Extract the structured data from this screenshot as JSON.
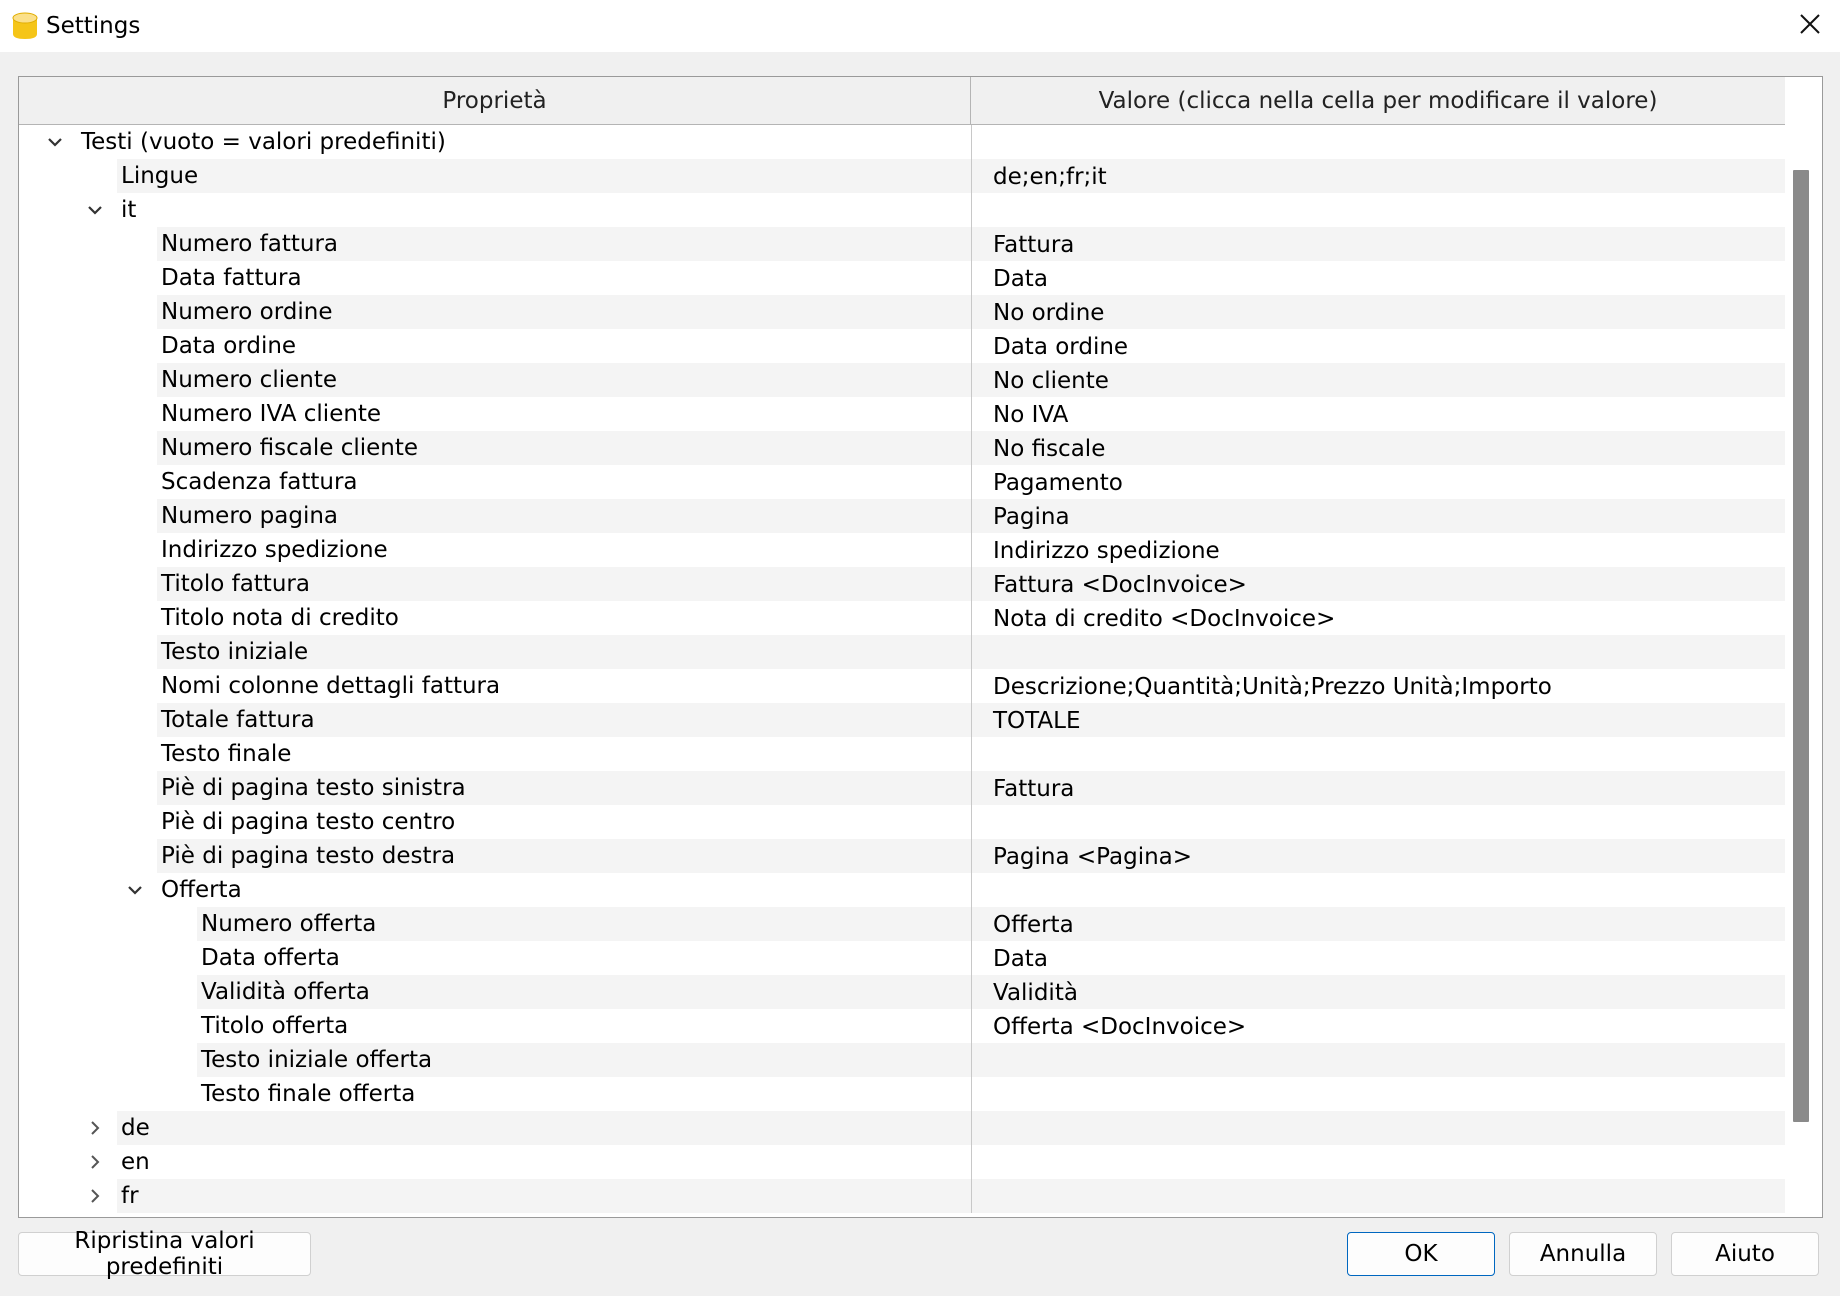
{
  "window": {
    "title": "Settings",
    "app_icon": "database-icon",
    "close_icon": "close-icon"
  },
  "table": {
    "columns": [
      "Proprietà",
      "Valore (clicca nella cella per modificare il valore)"
    ],
    "rows": [
      {
        "label": "Testi (vuoto = valori predefiniti)",
        "value": "",
        "level": 0,
        "expander": "expanded"
      },
      {
        "label": "Lingue",
        "value": "de;en;fr;it",
        "level": 1,
        "expander": "none"
      },
      {
        "label": "it",
        "value": "",
        "level": 1,
        "expander": "expanded"
      },
      {
        "label": "Numero fattura",
        "value": "Fattura",
        "level": 2,
        "expander": "none"
      },
      {
        "label": "Data fattura",
        "value": "Data",
        "level": 2,
        "expander": "none"
      },
      {
        "label": "Numero ordine",
        "value": "No ordine",
        "level": 2,
        "expander": "none"
      },
      {
        "label": "Data ordine",
        "value": "Data ordine",
        "level": 2,
        "expander": "none"
      },
      {
        "label": "Numero cliente",
        "value": "No cliente",
        "level": 2,
        "expander": "none"
      },
      {
        "label": "Numero IVA cliente",
        "value": "No IVA",
        "level": 2,
        "expander": "none"
      },
      {
        "label": "Numero fiscale cliente",
        "value": "No fiscale",
        "level": 2,
        "expander": "none"
      },
      {
        "label": "Scadenza fattura",
        "value": "Pagamento",
        "level": 2,
        "expander": "none"
      },
      {
        "label": "Numero pagina",
        "value": "Pagina",
        "level": 2,
        "expander": "none"
      },
      {
        "label": "Indirizzo spedizione",
        "value": "Indirizzo spedizione",
        "level": 2,
        "expander": "none"
      },
      {
        "label": "Titolo fattura",
        "value": "Fattura <DocInvoice>",
        "level": 2,
        "expander": "none"
      },
      {
        "label": "Titolo nota di credito",
        "value": "Nota di credito <DocInvoice>",
        "level": 2,
        "expander": "none"
      },
      {
        "label": "Testo iniziale",
        "value": "",
        "level": 2,
        "expander": "none"
      },
      {
        "label": "Nomi colonne dettagli fattura",
        "value": "Descrizione;Quantità;Unità;Prezzo Unità;Importo",
        "level": 2,
        "expander": "none"
      },
      {
        "label": "Totale fattura",
        "value": "TOTALE",
        "level": 2,
        "expander": "none"
      },
      {
        "label": "Testo finale",
        "value": "",
        "level": 2,
        "expander": "none"
      },
      {
        "label": "Piè di pagina testo sinistra",
        "value": "Fattura",
        "level": 2,
        "expander": "none"
      },
      {
        "label": "Piè di pagina testo centro",
        "value": "",
        "level": 2,
        "expander": "none"
      },
      {
        "label": "Piè di pagina testo destra",
        "value": "Pagina <Pagina>",
        "level": 2,
        "expander": "none"
      },
      {
        "label": "Offerta",
        "value": "",
        "level": 2,
        "expander": "expanded"
      },
      {
        "label": "Numero offerta",
        "value": "Offerta",
        "level": 3,
        "expander": "none"
      },
      {
        "label": "Data offerta",
        "value": "Data",
        "level": 3,
        "expander": "none"
      },
      {
        "label": "Validità offerta",
        "value": "Validità",
        "level": 3,
        "expander": "none"
      },
      {
        "label": "Titolo offerta",
        "value": "Offerta <DocInvoice>",
        "level": 3,
        "expander": "none"
      },
      {
        "label": "Testo iniziale offerta",
        "value": "",
        "level": 3,
        "expander": "none"
      },
      {
        "label": "Testo finale offerta",
        "value": "",
        "level": 3,
        "expander": "none"
      },
      {
        "label": "de",
        "value": "",
        "level": 1,
        "expander": "collapsed"
      },
      {
        "label": "en",
        "value": "",
        "level": 1,
        "expander": "collapsed"
      },
      {
        "label": "fr",
        "value": "",
        "level": 1,
        "expander": "collapsed"
      }
    ]
  },
  "buttons": {
    "restore": "Ripristina valori predefiniti",
    "ok": "OK",
    "cancel": "Annulla",
    "help": "Aiuto"
  },
  "colors": {
    "accent": "#0067c0",
    "app_icon": "#f5c518",
    "alt_row": "#f4f4f4",
    "scrollbar_thumb": "#8a8a8a"
  }
}
